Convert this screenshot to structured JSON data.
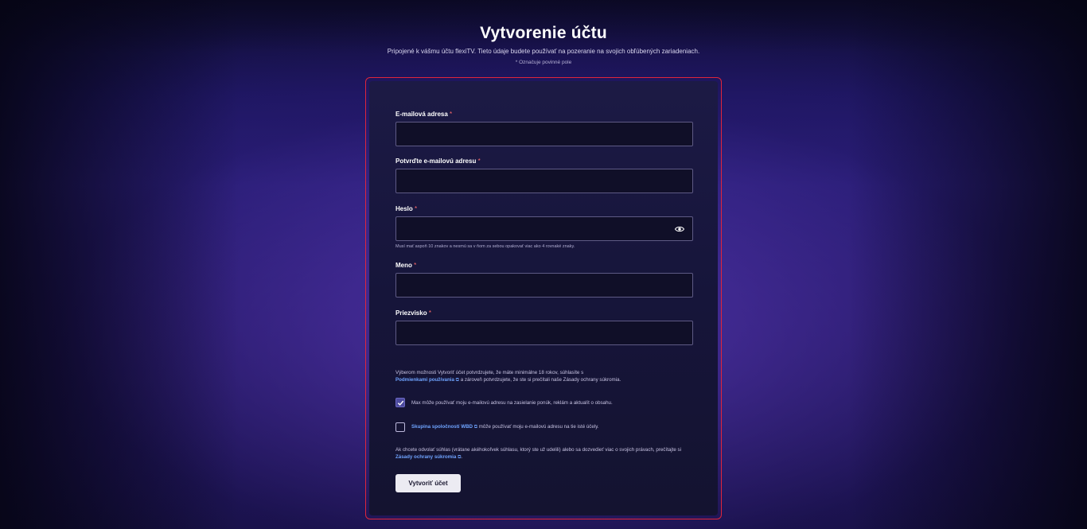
{
  "header": {
    "title": "Vytvorenie účtu",
    "subtitle": "Pripojené k vášmu účtu flexiTV. Tieto údaje budete používať na pozeranie na svojich obľúbených zariadeniach.",
    "required_note": "* Označuje povinné pole"
  },
  "form": {
    "email": {
      "label": "E-mailová adresa",
      "required_mark": "*",
      "value": "",
      "placeholder": ""
    },
    "confirm_email": {
      "label": "Potvrďte e-mailovú adresu",
      "required_mark": "*",
      "value": "",
      "placeholder": ""
    },
    "password": {
      "label": "Heslo",
      "required_mark": "*",
      "value": "",
      "placeholder": "",
      "icon": "eye-icon",
      "hint": "Musí mať aspoň 10 znakov a nesmú sa v ňom za sebou opakovať viac ako 4 rovnaké znaky."
    },
    "first_name": {
      "label": "Meno",
      "required_mark": "*",
      "value": "",
      "placeholder": ""
    },
    "last_name": {
      "label": "Priezvisko",
      "required_mark": "*",
      "value": "",
      "placeholder": ""
    }
  },
  "consent": {
    "terms_text_1": "Výberom možnosti Vytvoriť účet potvrdzujete, že máte minimálne 18 rokov, súhlasíte s",
    "terms_link": "Podmienkami používania",
    "terms_text_2": "a zároveň potvrdzujete, že ste si prečítali naše Zásady ochrany súkromia.",
    "marketing_checked": true,
    "marketing_label": "Max môže používať moju e-mailovú adresu na zasielanie ponúk, reklám a aktualít o obsahu.",
    "wbd_checked": false,
    "wbd_link": "Skupina spoločností WBD",
    "wbd_label": "môže používať moju e-mailovú adresu na tie isté účely.",
    "withdraw_text": "Ak chcete odvolať súhlas (vrátane akéhokoľvek súhlasu, ktorý ste už udelili) alebo sa dozvedieť viac o svojich právach, prečítajte si",
    "privacy_link": "Zásady ochrany súkromia",
    "external_icon": "⧉"
  },
  "submit": {
    "label": "Vytvoriť účet"
  },
  "colors": {
    "card_border": "#e0253b",
    "link": "#6fa4ff",
    "required": "#ff6b6b"
  }
}
